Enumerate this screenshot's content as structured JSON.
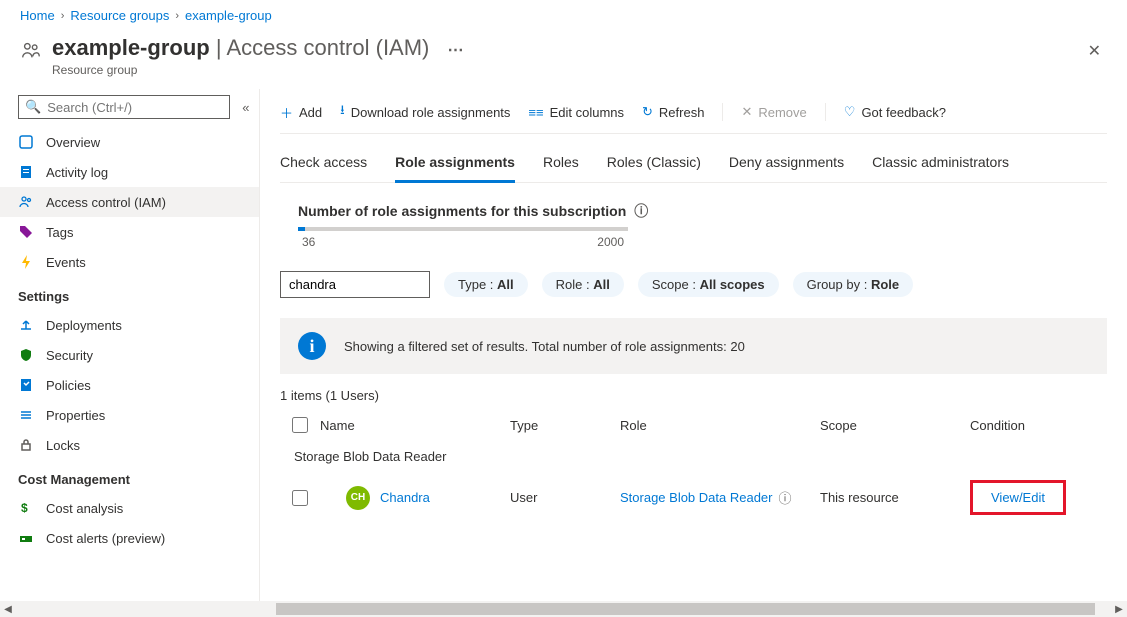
{
  "breadcrumb": [
    "Home",
    "Resource groups",
    "example-group"
  ],
  "header": {
    "title": "example-group",
    "section": "Access control (IAM)",
    "subtitle": "Resource group"
  },
  "sidebar": {
    "search_placeholder": "Search (Ctrl+/)",
    "items_top": [
      {
        "label": "Overview",
        "icon": "overview"
      },
      {
        "label": "Activity log",
        "icon": "log"
      },
      {
        "label": "Access control (IAM)",
        "icon": "people",
        "active": true
      },
      {
        "label": "Tags",
        "icon": "tag"
      },
      {
        "label": "Events",
        "icon": "events"
      }
    ],
    "section_settings": "Settings",
    "items_settings": [
      {
        "label": "Deployments",
        "icon": "deploy"
      },
      {
        "label": "Security",
        "icon": "security"
      },
      {
        "label": "Policies",
        "icon": "policies"
      },
      {
        "label": "Properties",
        "icon": "properties"
      },
      {
        "label": "Locks",
        "icon": "locks"
      }
    ],
    "section_cost": "Cost Management",
    "items_cost": [
      {
        "label": "Cost analysis",
        "icon": "cost"
      },
      {
        "label": "Cost alerts (preview)",
        "icon": "alerts"
      }
    ]
  },
  "toolbar": {
    "add": "Add",
    "download": "Download role assignments",
    "edit_columns": "Edit columns",
    "refresh": "Refresh",
    "remove": "Remove",
    "feedback": "Got feedback?"
  },
  "tabs": [
    "Check access",
    "Role assignments",
    "Roles",
    "Roles (Classic)",
    "Deny assignments",
    "Classic administrators"
  ],
  "active_tab": 1,
  "count": {
    "label": "Number of role assignments for this subscription",
    "current": 36,
    "max": 2000
  },
  "filters": {
    "search_value": "chandra",
    "type": {
      "label": "Type",
      "value": "All"
    },
    "role": {
      "label": "Role",
      "value": "All"
    },
    "scope": {
      "label": "Scope",
      "value": "All scopes"
    },
    "group_by": {
      "label": "Group by",
      "value": "Role"
    }
  },
  "info_banner": "Showing a filtered set of results. Total number of role assignments: 20",
  "items_count": "1 items (1 Users)",
  "columns": {
    "name": "Name",
    "type": "Type",
    "role": "Role",
    "scope": "Scope",
    "condition": "Condition"
  },
  "group_name": "Storage Blob Data Reader",
  "rows": [
    {
      "name": "Chandra",
      "initials": "CH",
      "type": "User",
      "role": "Storage Blob Data Reader",
      "scope": "This resource",
      "condition": "View/Edit"
    }
  ]
}
